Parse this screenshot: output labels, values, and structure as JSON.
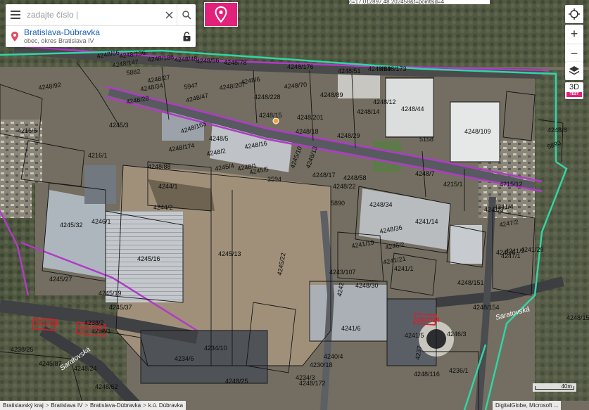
{
  "url_fragment": "c=17.012897,48.202458&t=point&d=4",
  "search": {
    "placeholder": "zadajte číslo |"
  },
  "result": {
    "title": "Bratislava-Dúbravka",
    "subtitle": "obec, okres Bratislava IV"
  },
  "controls": {
    "zoom_in": "+",
    "zoom_out": "−",
    "view_3d": "3D",
    "test_badge": "TEST"
  },
  "scale": {
    "label": "40m"
  },
  "attribution": "DigitalGlobe, Microsoft ...",
  "breadcrumb": [
    "Bratislavský kraj",
    "Bratislava IV",
    "Bratislava-Dúbravka",
    "k.ú. Dúbravka"
  ],
  "breadcrumb_separator": ">",
  "colors": {
    "accent": "#e2227a",
    "boundary": "#2fd6a4",
    "road_parcel": "#b13ac9",
    "highlight_parcel": "#d81f2a"
  },
  "road_labels": [
    "Saratovská",
    "Saratovská"
  ],
  "highlighted_parcels": [
    "2317/22",
    "2317/24",
    "2317/23"
  ],
  "parcel_labels": [
    "4248/66",
    "4248/136",
    "4248/147",
    "4248/186",
    "4248/48",
    "4248/56",
    "4248/78",
    "4248/176",
    "4248/51",
    "4248/69",
    "4248/173",
    "5882",
    "4248/27",
    "4248/207",
    "4248/6",
    "4248/70",
    "4248/89",
    "4248/92",
    "4248/34",
    "4248/28",
    "5947",
    "4248/47",
    "4248/228",
    "4248/12",
    "4248/44",
    "4248/14",
    "4248/15",
    "4248/201",
    "4248/18",
    "4248/29",
    "5158",
    "4248/109",
    "4245/3",
    "4248/5",
    "4248/2",
    "4248/16",
    "4248/174",
    "4248/165",
    "4245/10",
    "4248/1",
    "4245/5",
    "4245/4",
    "3594",
    "4248/13",
    "4248/17",
    "4248/22",
    "4248/58",
    "4248/7",
    "4215/1",
    "4215/12",
    "4248/88",
    "4248/8",
    "5893",
    "4244/1",
    "4244/2",
    "5890",
    "4248/34",
    "4241/14",
    "4241/3",
    "4241/4",
    "4247/2",
    "4247/1",
    "4245/6",
    "4245/32",
    "4246/1",
    "4248/36",
    "4246/2",
    "4245/13",
    "4245/16",
    "4245/22",
    "4241/19",
    "4241/21",
    "4241/1",
    "4241/2",
    "4241/29",
    "4248/151",
    "4248/154",
    "4248/153",
    "4245/27",
    "4245/19",
    "4245/37",
    "4243/107",
    "4242",
    "4248/30",
    "4241/6",
    "4241/5",
    "4237",
    "4236/1",
    "4246/3",
    "4238/2",
    "4238/1",
    "4234/10",
    "4234/6",
    "4248/25",
    "4238/25",
    "4245/87",
    "4240/4",
    "4230/18",
    "4234/3",
    "4248/172",
    "4248/116",
    "4248/62",
    "4248/24",
    "4216/6",
    "4216/1"
  ]
}
